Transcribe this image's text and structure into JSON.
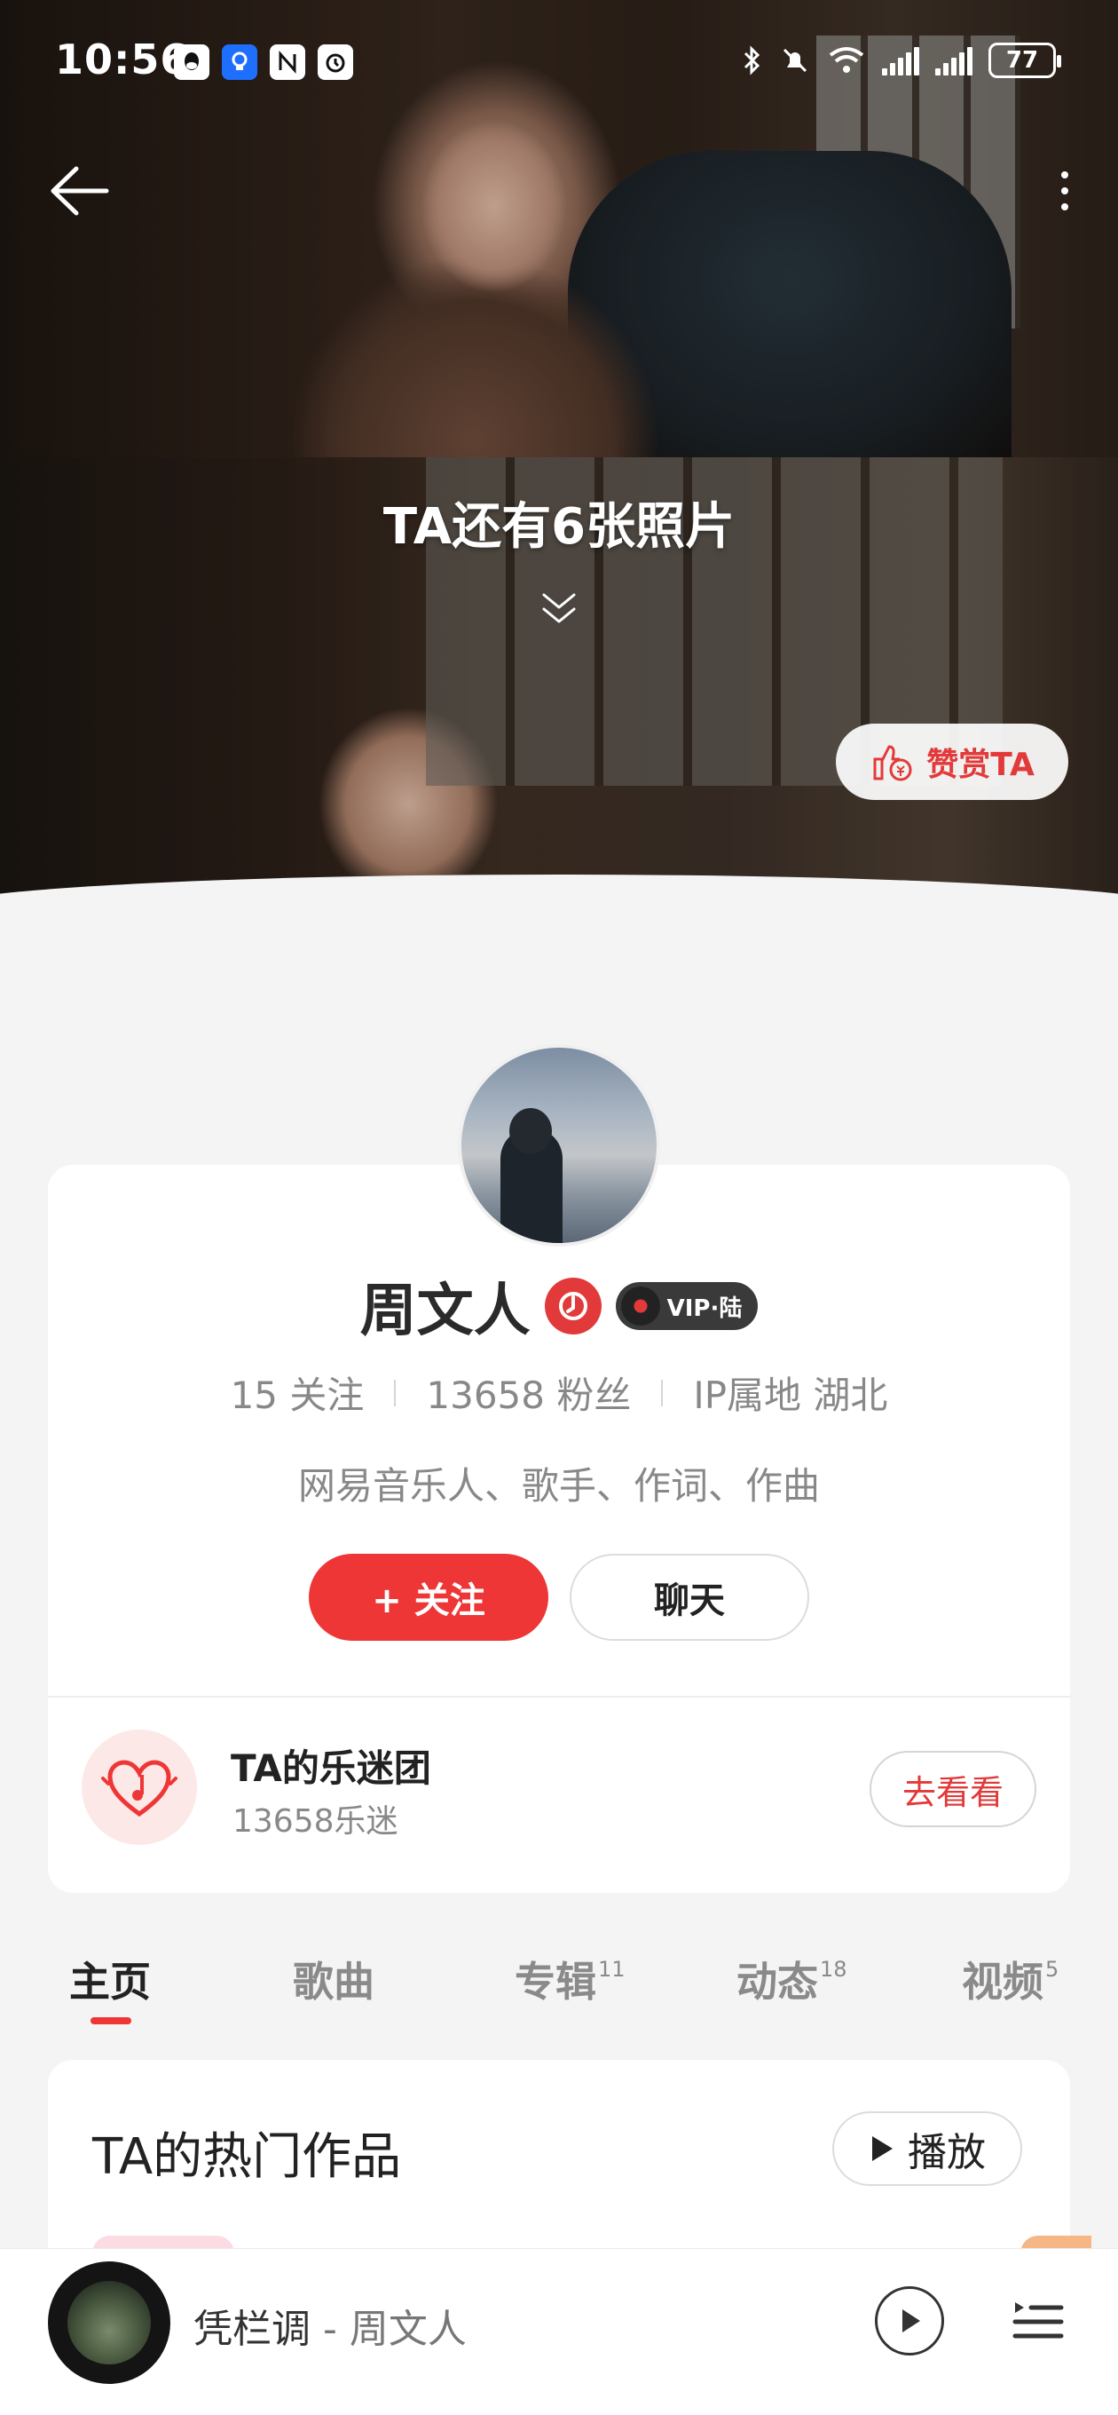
{
  "status_bar": {
    "time": "10:56",
    "battery": "77",
    "network": "6"
  },
  "header": {
    "more_photos": "TA还有6张照片",
    "reward_label": "赞赏TA"
  },
  "profile": {
    "name": "周文人",
    "vip_label": "VIP·陆",
    "following": "15 关注",
    "followers": "13658 粉丝",
    "ip_location": "IP属地 湖北",
    "bio": "网易音乐人、歌手、作词、作曲",
    "follow_label": "+ 关注",
    "chat_label": "聊天"
  },
  "fan_club": {
    "title": "TA的乐迷团",
    "count": "13658乐迷",
    "go_label": "去看看"
  },
  "tabs": [
    {
      "label": "主页",
      "badge": ""
    },
    {
      "label": "歌曲",
      "badge": ""
    },
    {
      "label": "专辑",
      "badge": "11"
    },
    {
      "label": "动态",
      "badge": "18"
    },
    {
      "label": "视频",
      "badge": "5"
    }
  ],
  "hot_works": {
    "title": "TA的热门作品",
    "play_label": "播放"
  },
  "player": {
    "song": "凭栏调",
    "separator": " - ",
    "artist": "周文人"
  },
  "colors": {
    "accent": "#ee3636",
    "page_bg": "#f4f4f4"
  }
}
